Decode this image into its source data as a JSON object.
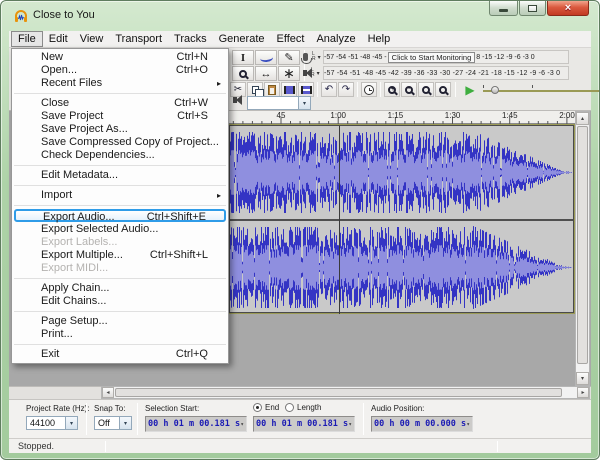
{
  "window": {
    "title": "Close to You"
  },
  "menubar": {
    "items": [
      "File",
      "Edit",
      "View",
      "Transport",
      "Tracks",
      "Generate",
      "Effect",
      "Analyze",
      "Help"
    ],
    "active": "File"
  },
  "file_menu": {
    "items": [
      {
        "label": "New",
        "shortcut": "Ctrl+N"
      },
      {
        "label": "Open...",
        "shortcut": "Ctrl+O"
      },
      {
        "label": "Recent Files",
        "submenu": true
      },
      {
        "sep": true
      },
      {
        "label": "Close",
        "shortcut": "Ctrl+W"
      },
      {
        "label": "Save Project",
        "shortcut": "Ctrl+S"
      },
      {
        "label": "Save Project As..."
      },
      {
        "label": "Save Compressed Copy of Project..."
      },
      {
        "label": "Check Dependencies..."
      },
      {
        "sep": true
      },
      {
        "label": "Edit Metadata..."
      },
      {
        "sep": true
      },
      {
        "label": "Import",
        "submenu": true
      },
      {
        "sep": true
      },
      {
        "label": "Export Audio...",
        "shortcut": "Ctrl+Shift+E",
        "highlighted": true
      },
      {
        "label": "Export Selected Audio..."
      },
      {
        "label": "Export Labels...",
        "disabled": true
      },
      {
        "label": "Export Multiple...",
        "shortcut": "Ctrl+Shift+L"
      },
      {
        "label": "Export MIDI...",
        "disabled": true
      },
      {
        "sep": true
      },
      {
        "label": "Apply Chain..."
      },
      {
        "label": "Edit Chains..."
      },
      {
        "sep": true
      },
      {
        "label": "Page Setup..."
      },
      {
        "label": "Print..."
      },
      {
        "sep": true
      },
      {
        "label": "Exit",
        "shortcut": "Ctrl+Q"
      }
    ]
  },
  "toolbars": {
    "meters": {
      "record": {
        "left_scale": "-57 -54 -51 -48 -45 -",
        "monitor_label": "Click to Start Monitoring",
        "right_scale": "8 -15 -12 -9 -6 -3 0"
      },
      "play": {
        "scale": "-57 -54 -51 -48 -45 -42 -39 -36 -33 -30 -27 -24 -21 -18 -15 -12 -9 -6 -3 0"
      }
    }
  },
  "ruler": {
    "labels": [
      "45",
      "1:00",
      "1:15",
      "1:30",
      "1:45",
      "2:00"
    ]
  },
  "selection_toolbar": {
    "project_rate_label": "Project Rate (Hz):",
    "project_rate_value": "44100",
    "snap_label": "Snap To:",
    "snap_value": "Off",
    "selection_start_label": "Selection Start:",
    "end_label": "End",
    "length_label": "Length",
    "selection_start_value": "00 h 01 m 00.181 s",
    "end_value": "00 h 01 m 00.181 s",
    "audio_position_label": "Audio Position:",
    "audio_position_value": "00 h 00 m 00.000 s"
  },
  "status_bar": {
    "text": "Stopped."
  },
  "colors": {
    "highlight_box": "#2f9ce8",
    "waveform": "#3434c4",
    "waveform_rms": "#8f8fdf",
    "titlebar_green": "#bcd8b5"
  }
}
